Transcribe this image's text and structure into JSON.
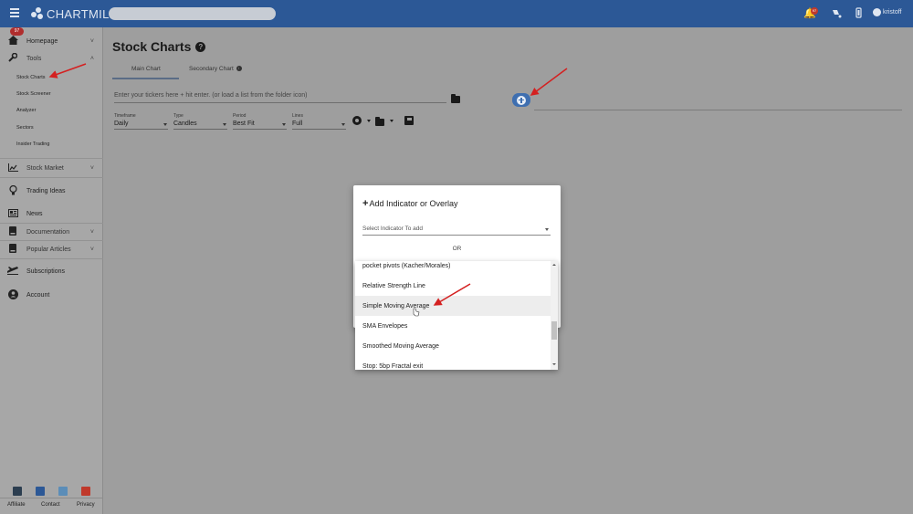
{
  "app": {
    "name": "CHARTMILL"
  },
  "topbar": {
    "notifications_count": "97",
    "username": "kristoff",
    "icons": [
      "menu-icon",
      "bell-icon",
      "palette-icon",
      "battery-icon",
      "user-icon"
    ]
  },
  "sidebar": {
    "homepage_badge": "97",
    "items": [
      {
        "label": "Homepage",
        "icon": "home-icon"
      },
      {
        "label": "Tools",
        "icon": "wrench-icon"
      },
      {
        "label": "Stock Market",
        "icon": "chart-icon"
      },
      {
        "label": "Trading Ideas",
        "icon": "lightbulb-icon"
      },
      {
        "label": "News",
        "icon": "news-icon"
      },
      {
        "label": "Documentation",
        "icon": "book-icon"
      },
      {
        "label": "Popular Articles",
        "icon": "book-icon"
      },
      {
        "label": "Subscriptions",
        "icon": "plane-icon"
      },
      {
        "label": "Account",
        "icon": "account-icon"
      }
    ],
    "tools_sub": [
      "Stock Charts",
      "Stock Screener",
      "Analyzer",
      "Sectors",
      "Insider Trading"
    ],
    "footer": {
      "affiliate": "Affiliate",
      "contact": "Contact",
      "privacy": "Privacy"
    }
  },
  "main": {
    "title": "Stock Charts",
    "tabs": [
      {
        "label": "Main Chart"
      },
      {
        "label": "Secondary Chart"
      }
    ],
    "ticker_placeholder": "Enter your tickers here + hit enter. (or load a list from the folder icon)",
    "selects": [
      {
        "label": "Timeframe",
        "value": "Daily"
      },
      {
        "label": "Type",
        "value": "Candles"
      },
      {
        "label": "Period",
        "value": "Best Fit"
      },
      {
        "label": "Lines",
        "value": "Full"
      }
    ]
  },
  "modal": {
    "title": "Add Indicator or Overlay",
    "select_placeholder": "Select Indicator To add",
    "or_text": "OR",
    "options": [
      "pocket pivots (Kacher/Morales)",
      "Relative Strength Line",
      "Simple Moving Average",
      "SMA Envelopes",
      "Smoothed Moving Average",
      "Stop: 5bp Fractal exit"
    ],
    "highlighted_option": "Simple Moving Average"
  },
  "colors": {
    "topbar": "#2c5896",
    "accent": "#3f6fb0",
    "annotation_arrow": "#d42020"
  }
}
